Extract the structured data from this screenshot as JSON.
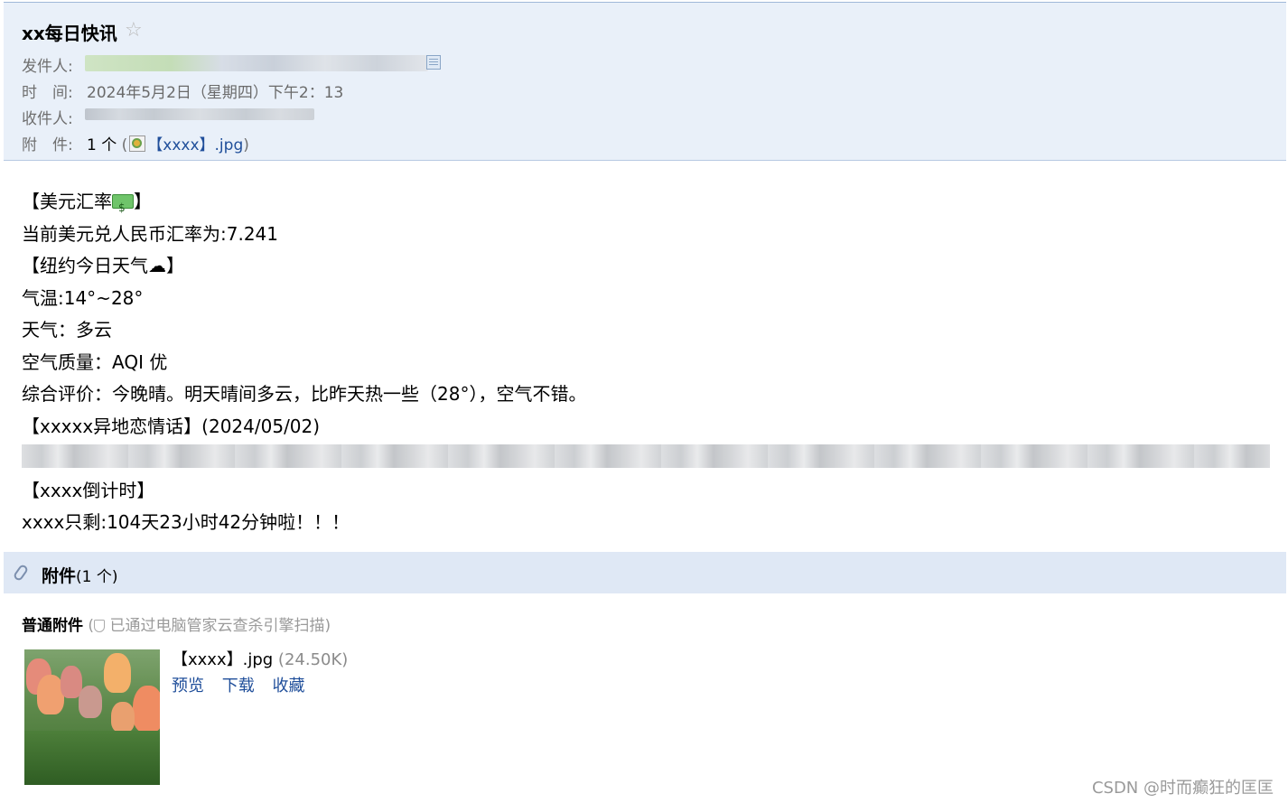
{
  "header": {
    "subject": "xx每日快讯",
    "star_icon": "star-outline-icon",
    "sender_label": "发件人:",
    "time_label": "时　间:",
    "time_value": "2024年5月2日（星期四）下午2：13",
    "recipient_label": "收件人:",
    "attachment_label": "附　件:",
    "attachment_count": "1 个",
    "attachment_open": " (",
    "attachment_name": "【xxxx】.jpg",
    "attachment_close": ")"
  },
  "body": {
    "lines": [
      "【美元汇率",
      "当前美元兑人民币汇率为:7.241",
      "【纽约今日天气",
      "气温:14°~28°",
      "天气：多云",
      "空气质量：AQI 优",
      "综合评价：今晚晴。明天晴间多云，比昨天热一些（28°），空气不错。",
      "【xxxxx异地恋情话】(2024/05/02)",
      "【xxxx倒计时】",
      "xxxx只剩:104天23小时42分钟啦！！！"
    ],
    "close_bracket": "】",
    "cloud_glyph": "☁"
  },
  "attachments": {
    "title": "附件",
    "count": "(1 个)",
    "normal_label": "普通附件",
    "scan_text": "已通过电脑管家云查杀引擎扫描)",
    "scan_open": "(",
    "file_name": "【xxxx】.jpg",
    "file_size": "(24.50K)",
    "actions": [
      "预览",
      "下载",
      "收藏"
    ]
  },
  "watermark": "CSDN @时而癫狂的匡匡"
}
